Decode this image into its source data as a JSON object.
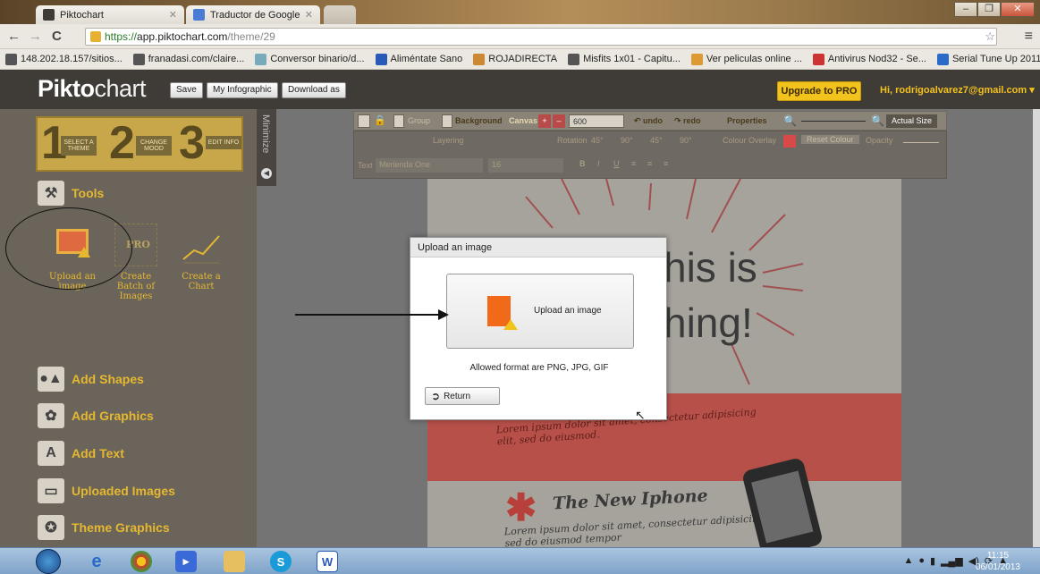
{
  "browser": {
    "tabs": [
      {
        "title": "Piktochart"
      },
      {
        "title": "Traductor de Google"
      }
    ],
    "url": {
      "scheme": "https://",
      "domain": "app.piktochart.com",
      "path": "/theme/29"
    },
    "bookmarks": [
      "148.202.18.157/sitios...",
      "franadasi.com/claire...",
      "Conversor binario/d...",
      "Aliméntate Sano",
      "ROJADIRECTA",
      "Misfits 1x01 - Capitu...",
      "Ver peliculas online ...",
      "Antivirus Nod32 - Se...",
      "Serial Tune Up 2011 ..."
    ]
  },
  "app": {
    "logo_bold": "Pikto",
    "logo_thin": "chart",
    "buttons": {
      "save": "Save",
      "my_infographic": "My Infographic",
      "download": "Download as"
    },
    "upgrade": "Upgrade to PRO",
    "user": "Hi, rodrigoalvarez7@gmail.com ▾"
  },
  "sidebar": {
    "steps": [
      {
        "num": "1",
        "label": "SELECT A THEME"
      },
      {
        "num": "2",
        "label": "CHANGE MOOD"
      },
      {
        "num": "3",
        "label": "EDIT INFO"
      }
    ],
    "minimize": "Minimize",
    "tools_title": "Tools",
    "tools": [
      {
        "label": "Upload an image"
      },
      {
        "label": "Create Batch of Images",
        "badge": "PRO"
      },
      {
        "label": "Create a Chart"
      }
    ],
    "sections": [
      "Add Shapes",
      "Add Graphics",
      "Add Text",
      "Uploaded Images",
      "Theme Graphics"
    ]
  },
  "toolbar": {
    "group": "Group",
    "background": "Background",
    "canvas": "Canvas",
    "canvas_value": "600",
    "undo": "undo",
    "redo": "redo",
    "properties": "Properties",
    "actual_size": "Actual Size",
    "layering": "Layering",
    "rotation": "Rotation",
    "rot_vals": [
      "45°",
      "90°",
      "45°",
      "90°"
    ],
    "colour_overlay": "Colour Overlay",
    "reset_colour": "Reset Colour",
    "opacity": "Opacity",
    "text_label": "Text",
    "font": "Merienda One",
    "font_size": "16"
  },
  "canvas": {
    "headline1": "his is",
    "headline2": "hing!",
    "lorem1": "Lorem ipsum dolor sit amet, consectetur adipisicing elit, sed do eiusmod.",
    "subtitle": "The New Iphone",
    "lorem2": "Lorem ipsum dolor sit amet, consectetur adipisicing elit sed do eiusmod tempor"
  },
  "modal": {
    "title": "Upload an image",
    "upload_label": "Upload an image",
    "allowed": "Allowed format are PNG, JPG, GIF",
    "return": "Return"
  },
  "taskbar": {
    "time": "11:15",
    "date": "06/01/2013"
  },
  "colors": {
    "accent": "#f2c21d",
    "header": "#3f3b37",
    "sidebar": "#6a645b",
    "red_band": "#b8504a"
  }
}
